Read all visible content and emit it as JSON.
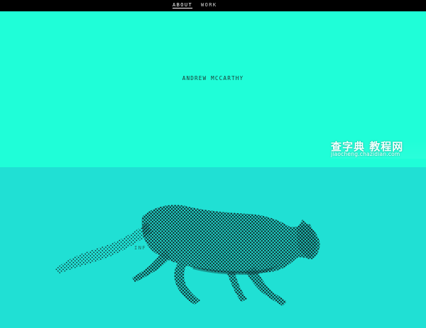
{
  "nav": {
    "items": [
      {
        "label": "ABOUT"
      },
      {
        "label": "WORK"
      }
    ]
  },
  "hero": {
    "name": "ANDREW MCCARTHY"
  },
  "lower": {
    "partial_text": "INF"
  },
  "watermark": {
    "top": "查字典 教程网",
    "bottom": "jiaocheng.chazidian.com"
  },
  "colors": {
    "topbar": "#000000",
    "hero_bg": "#1ffed8",
    "lower_bg": "#20e0d4",
    "cat": "#0f2a2c"
  },
  "icons": [
    "running-cat-halftone-image"
  ]
}
